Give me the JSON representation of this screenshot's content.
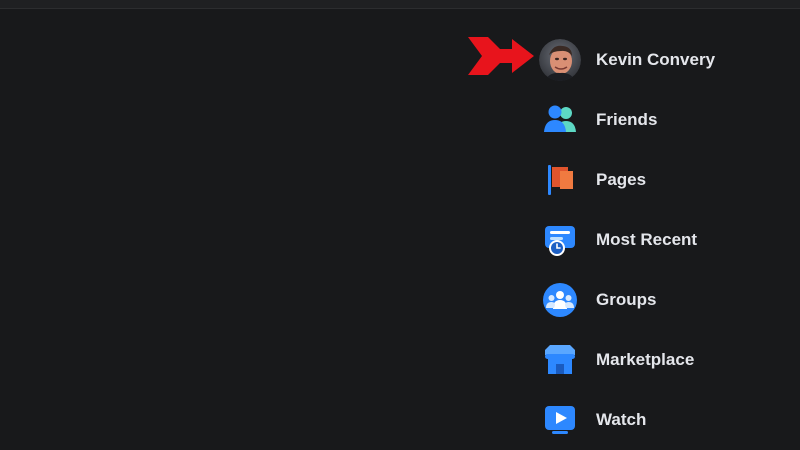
{
  "colors": {
    "background": "#18191b",
    "label_text": "#e4e6eb",
    "annotation_arrow": "#e8141c",
    "accent_blue": "#2d88ff"
  },
  "annotation": {
    "icon": "red-arrow-icon",
    "points_to": "profile"
  },
  "nav": {
    "items": [
      {
        "id": "profile",
        "label": "Kevin Convery",
        "icon": "avatar"
      },
      {
        "id": "friends",
        "label": "Friends",
        "icon": "friends-icon"
      },
      {
        "id": "pages",
        "label": "Pages",
        "icon": "flag-icon"
      },
      {
        "id": "most-recent",
        "label": "Most Recent",
        "icon": "feed-clock-icon"
      },
      {
        "id": "groups",
        "label": "Groups",
        "icon": "groups-icon"
      },
      {
        "id": "marketplace",
        "label": "Marketplace",
        "icon": "storefront-icon"
      },
      {
        "id": "watch",
        "label": "Watch",
        "icon": "video-play-icon"
      }
    ]
  }
}
